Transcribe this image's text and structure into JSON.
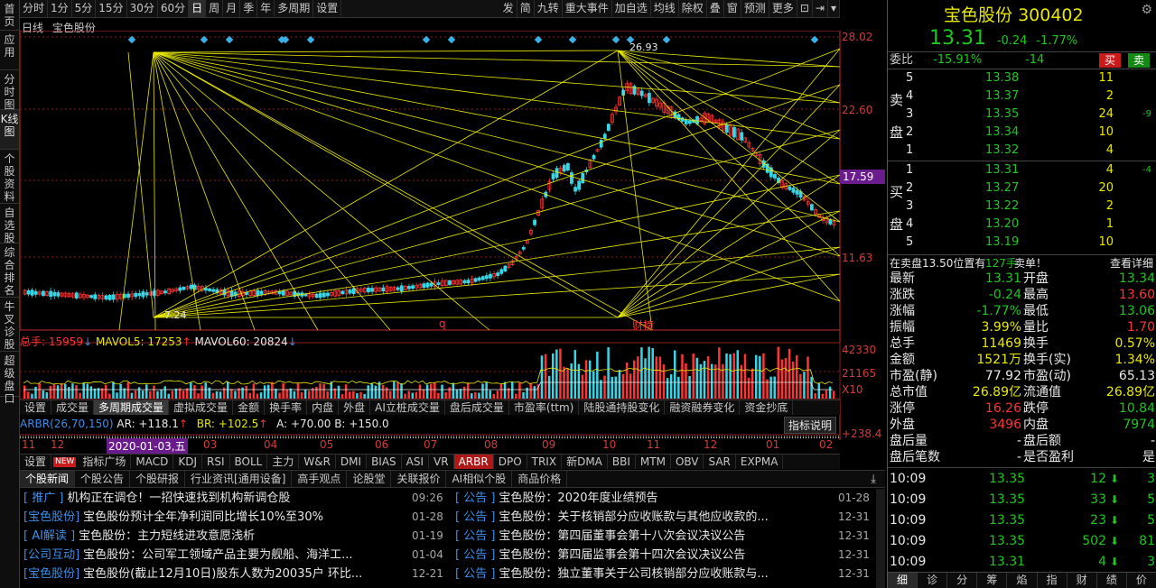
{
  "sidebar_tabs": [
    "首页",
    "应用",
    "分时图",
    "K线图",
    "个股资料",
    "自选股",
    "综合排名",
    "牛叉诊股",
    "超级盘口"
  ],
  "period_buttons": [
    "分时",
    "1分",
    "5分",
    "15分",
    "30分",
    "60分",
    "日",
    "周",
    "月",
    "季",
    "年",
    "多周期",
    "设置"
  ],
  "right_toolbar": [
    "发",
    "简",
    "九转",
    "重大事件",
    "加自选",
    "均线",
    "除权",
    "叠",
    "窗",
    "预测",
    "更多"
  ],
  "chart_info": {
    "label": "日线",
    "stock": "宝色股份"
  },
  "price_axis": [
    "28.02",
    "22.60",
    "17.59",
    "11.63"
  ],
  "high_label": "26.93",
  "low_label": "7.24",
  "markers": {
    "q": "q",
    "cb": "财榜"
  },
  "volume_legend": {
    "total_label": "总手:",
    "total_value": "15959",
    "mavol5_label": "MAVOL5:",
    "mavol5_value": "17253",
    "mavol60_label": "MAVOL60:",
    "mavol60_value": "20824"
  },
  "volume_axis": [
    "42330",
    "21165",
    "X10"
  ],
  "indicator_tabs1": [
    "设置",
    "成交量",
    "多周期成交量",
    "虚拟成交量",
    "金额",
    "换手率",
    "内盘",
    "外盘",
    "AI立桩成交量",
    "盘后成交量",
    "市盈率(ttm)",
    "陆股通持股变化",
    "融资融券变化",
    "资金抄底"
  ],
  "arbr_legend": {
    "title": "ARBR(26,70,150)",
    "ar": "AR: +118.1",
    "br": "BR: +102.5",
    "a": "A: +70.00",
    "b": "B: +150.0",
    "button": "指标说明"
  },
  "arbr_axis": "+238.4",
  "dates": {
    "selected": "2020-01-03,五",
    "labels": [
      "11",
      "12",
      "03",
      "04",
      "05",
      "06",
      "07",
      "08",
      "09",
      "10",
      "11",
      "12",
      "01",
      "02"
    ]
  },
  "indicator_tabs2": [
    "设置",
    "指标广场",
    "MACD",
    "KDJ",
    "RSI",
    "BOLL",
    "主力",
    "W&R",
    "DMI",
    "BIAS",
    "ASI",
    "VR",
    "ARBR",
    "DPO",
    "TRIX",
    "新DMA",
    "BBI",
    "MTM",
    "OBV",
    "SAR",
    "EXPMA"
  ],
  "new_badge": "NEW",
  "news_tabs": [
    "个股新闻",
    "个股公告",
    "个股研报",
    "行业资讯[通用设备]",
    "高手观点",
    "论股堂",
    "关联报价",
    "AI相似个股",
    "商品价格"
  ],
  "news_left": [
    {
      "tag": "[ 推广 ]",
      "title": "机构正在调仓！一招快速找到机构新调仓股",
      "date": "09:26"
    },
    {
      "tag": "[宝色股份]",
      "title": "宝色股份预计全年净利润同比增长10%至30%",
      "date": "01-28"
    },
    {
      "tag": "[ AI解读 ]",
      "title": "宝色股份：主力短线进攻意愿浅析",
      "date": "01-19"
    },
    {
      "tag": "[公司互动]",
      "title": "宝色股份：公司军工领域产品主要为舰船、海洋工...",
      "date": "01-04"
    },
    {
      "tag": "[宝色股份]",
      "title": "宝色股份(截止12月10日)股东人数为20035户 环比...",
      "date": "12-21"
    }
  ],
  "news_right": [
    {
      "tag": "[ 公告 ]",
      "title": "宝色股份：2020年度业绩预告",
      "date": "01-28"
    },
    {
      "tag": "[ 公告 ]",
      "title": "宝色股份：关于核销部分应收账款与其他应收款的...",
      "date": "12-31"
    },
    {
      "tag": "[ 公告 ]",
      "title": "宝色股份：第四届董事会第十八次会议决议公告",
      "date": "12-31"
    },
    {
      "tag": "[ 公告 ]",
      "title": "宝色股份：第四届监事会第十四次会议决议公告",
      "date": "12-31"
    },
    {
      "tag": "[ 公告 ]",
      "title": "宝色股份：独立董事关于公司核销部分应收账款与...",
      "date": "12-31"
    }
  ],
  "quote": {
    "name": "宝色股份",
    "code": "300402",
    "price": "13.31",
    "change": "-0.24",
    "change_pct": "-1.77%",
    "weibi_label": "委比",
    "weibi": "-15.91%",
    "weicha": "-14",
    "buy_btn": "买",
    "sell_btn": "卖",
    "sell_label": [
      "卖",
      "盘"
    ],
    "buy_label": [
      "买",
      "盘"
    ],
    "asks": [
      {
        "level": "5",
        "price": "13.38",
        "vol": "11",
        "chg": ""
      },
      {
        "level": "4",
        "price": "13.37",
        "vol": "2",
        "chg": ""
      },
      {
        "level": "3",
        "price": "13.35",
        "vol": "24",
        "chg": "-9"
      },
      {
        "level": "2",
        "price": "13.34",
        "vol": "10",
        "chg": ""
      },
      {
        "level": "1",
        "price": "13.32",
        "vol": "4",
        "chg": ""
      }
    ],
    "bids": [
      {
        "level": "1",
        "price": "13.31",
        "vol": "4",
        "chg": "-4"
      },
      {
        "level": "2",
        "price": "13.27",
        "vol": "20",
        "chg": ""
      },
      {
        "level": "3",
        "price": "13.22",
        "vol": "2",
        "chg": ""
      },
      {
        "level": "4",
        "price": "13.20",
        "vol": "1",
        "chg": ""
      },
      {
        "level": "5",
        "price": "13.19",
        "vol": "10",
        "chg": ""
      }
    ],
    "notice": {
      "prefix": "在卖盘13.50位置有",
      "qty": "127手",
      "suffix": "卖单！",
      "link": "查看详细"
    },
    "stats": [
      {
        "l1": "最新",
        "v1": "13.31",
        "c1": "green",
        "l2": "开盘",
        "v2": "13.34",
        "c2": "green"
      },
      {
        "l1": "涨跌",
        "v1": "-0.24",
        "c1": "green",
        "l2": "最高",
        "v2": "13.60",
        "c2": "red"
      },
      {
        "l1": "涨幅",
        "v1": "-1.77%",
        "c1": "green",
        "l2": "最低",
        "v2": "13.06",
        "c2": "green"
      },
      {
        "l1": "振幅",
        "v1": "3.99%",
        "c1": "yellow",
        "l2": "量比",
        "v2": "1.70",
        "c2": "red"
      },
      {
        "l1": "总手",
        "v1": "11469",
        "c1": "yellow",
        "l2": "换手",
        "v2": "0.57%",
        "c2": "yellow"
      },
      {
        "l1": "金额",
        "v1": "1521万",
        "c1": "yellow",
        "l2": "换手(实)",
        "v2": "1.34%",
        "c2": "yellow"
      },
      {
        "l1": "市盈(静)",
        "v1": "77.92",
        "c1": "white",
        "l2": "市盈(动)",
        "v2": "65.13",
        "c2": "white"
      },
      {
        "l1": "总市值",
        "v1": "26.89亿",
        "c1": "yellow",
        "l2": "流通值",
        "v2": "26.89亿",
        "c2": "yellow"
      },
      {
        "l1": "涨停",
        "v1": "16.26",
        "c1": "red",
        "l2": "跌停",
        "v2": "10.84",
        "c2": "green"
      },
      {
        "l1": "外盘",
        "v1": "3496",
        "c1": "red",
        "l2": "内盘",
        "v2": "7974",
        "c2": "green"
      },
      {
        "l1": "盘后量",
        "v1": "-",
        "c1": "white",
        "l2": "盘后额",
        "v2": "-",
        "c2": "white"
      },
      {
        "l1": "盘后笔数",
        "v1": "-",
        "c1": "white",
        "l2": "是否盈利",
        "v2": "是",
        "c2": "white"
      }
    ],
    "ticks": [
      {
        "time": "10:09",
        "price": "13.35",
        "vol": "12",
        "n": "3"
      },
      {
        "time": "10:09",
        "price": "13.35",
        "vol": "33",
        "n": "5"
      },
      {
        "time": "10:09",
        "price": "13.35",
        "vol": "23",
        "n": "5"
      },
      {
        "time": "10:09",
        "price": "13.35",
        "vol": "502",
        "n": "81"
      },
      {
        "time": "10:09",
        "price": "13.31",
        "vol": "4",
        "n": "3"
      }
    ],
    "bottom_tabs": [
      "细",
      "诊",
      "分",
      "筹",
      "焰",
      "指",
      "财",
      "绩",
      "价"
    ]
  },
  "colors": {
    "up": "#ff3333",
    "down": "#1ec71e",
    "grid": "#c72a2a",
    "accent": "#e8e800",
    "tag": "#3b8eea"
  }
}
